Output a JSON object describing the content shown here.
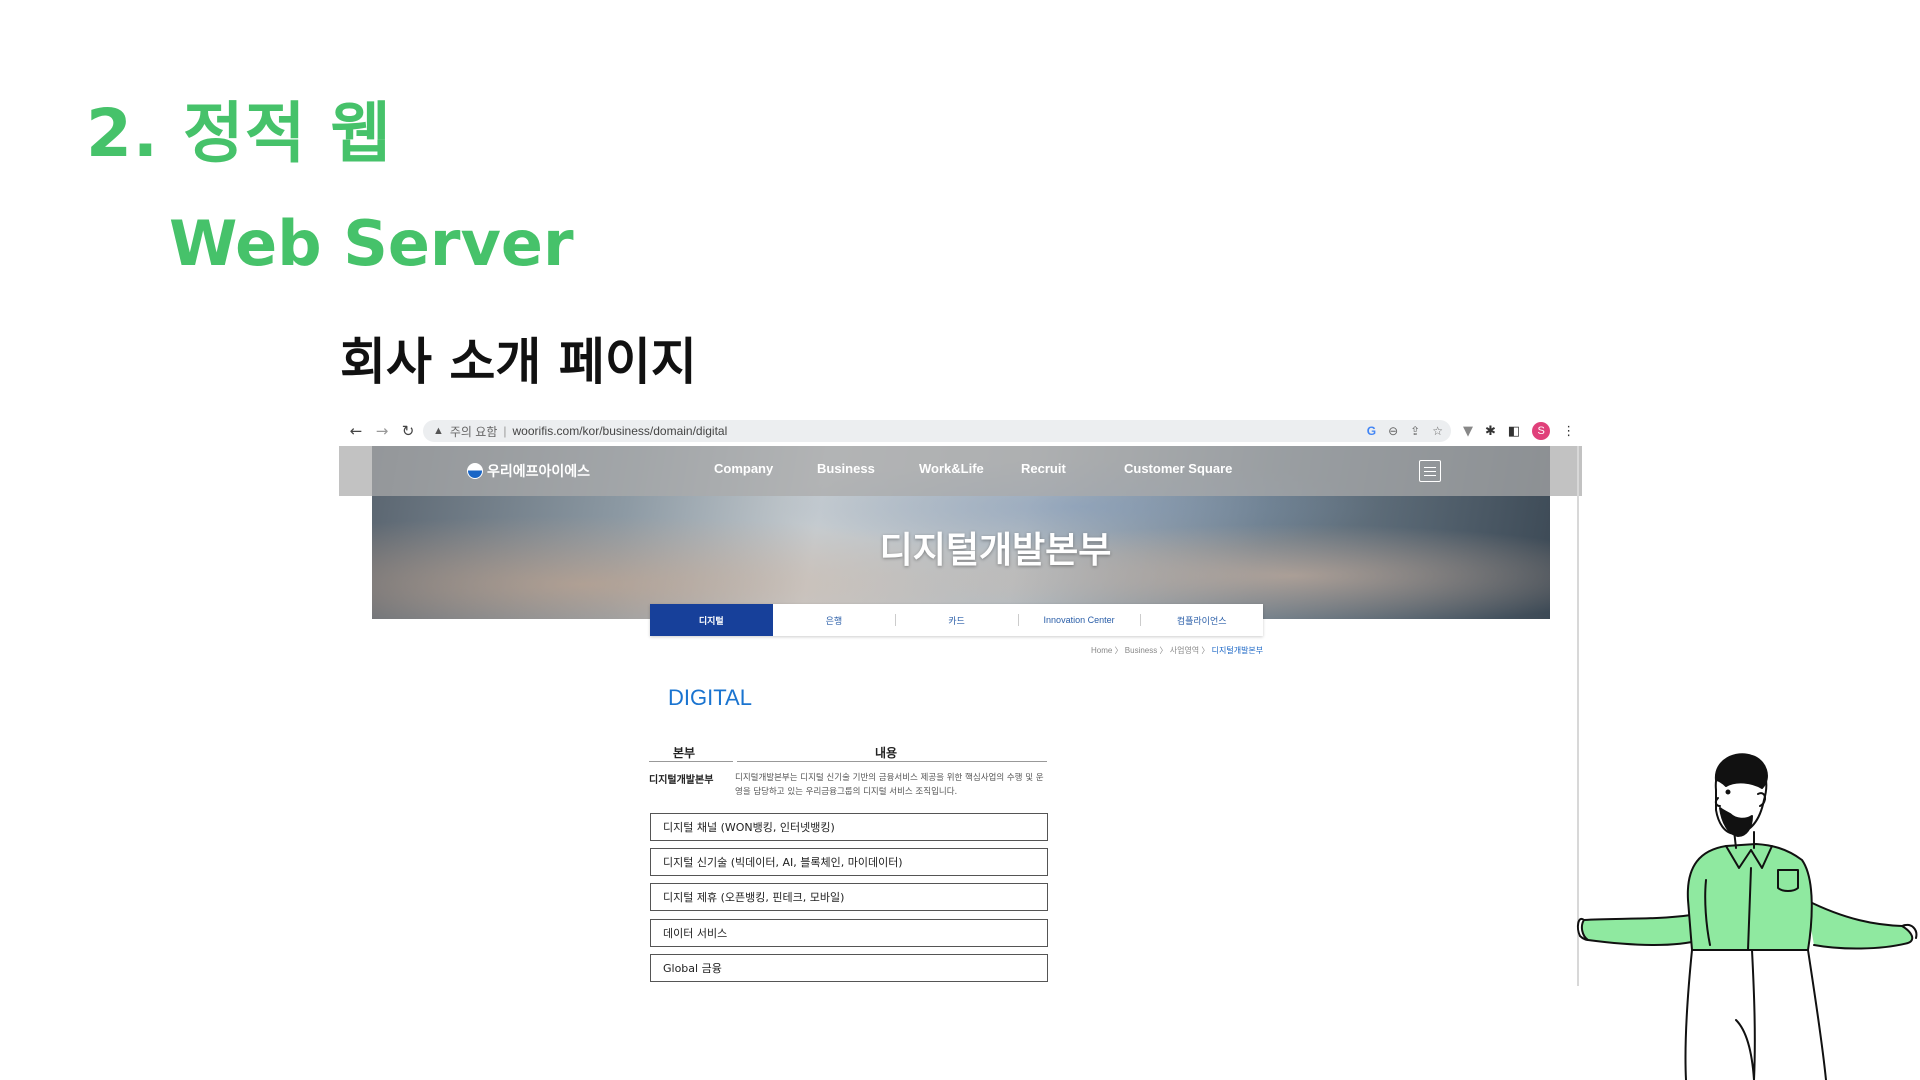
{
  "slide": {
    "heading_main": "2. 정적 웹",
    "heading_sub": "Web Server",
    "heading_page": "회사 소개 페이지"
  },
  "browser": {
    "security_warning": "주의 요함",
    "url": "woorifis.com/kor/business/domain/digital",
    "profile_initial": "S"
  },
  "site": {
    "logo_text": "우리에프아이에스",
    "nav": [
      "Company",
      "Business",
      "Work&Life",
      "Recruit",
      "Customer Square"
    ],
    "hero_title": "디지털개발본부",
    "tabs": [
      "디지털",
      "은행",
      "카드",
      "Innovation Center",
      "컴플라이언스"
    ],
    "active_tab": "디지털",
    "breadcrumb": [
      "Home",
      "Business",
      "사업영역",
      "디지털개발본부"
    ],
    "section_title": "DIGITAL",
    "table": {
      "col_dept": "본부",
      "col_content": "내용",
      "dept": "디지털개발본부",
      "description": "디지털개발본부는 디지털 신기술 기반의 금융서비스 제공을 위한 핵심사업의 수행 및 운영을 담당하고 있는 우리금융그룹의 디지털 서비스 조직입니다."
    },
    "items": [
      "디지털 채널 (WON뱅킹, 인터넷뱅킹)",
      "디지털 신기술 (빅데이터, AI, 블록체인, 마이데이터)",
      "디지털 제휴 (오픈뱅킹, 핀테크, 모바일)",
      "데이터 서비스",
      "Global 금융"
    ]
  },
  "colors": {
    "accent_green": "#46c26a",
    "tab_active": "#17409a",
    "section_blue": "#1a74d0",
    "illustration_shirt": "#8fe9a0"
  }
}
